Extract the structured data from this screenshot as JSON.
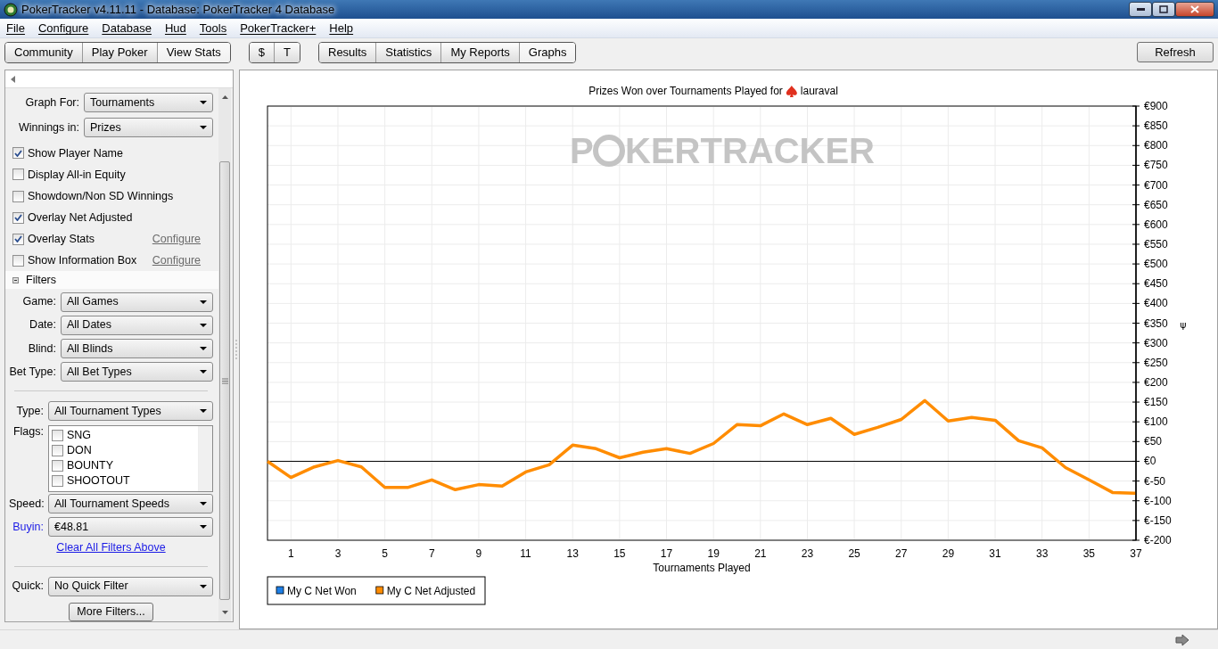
{
  "window": {
    "title": "PokerTracker v4.11.11 - Database: PokerTracker 4 Database"
  },
  "menu": [
    "File",
    "Configure",
    "Database",
    "Hud",
    "Tools",
    "PokerTracker+",
    "Help"
  ],
  "toolbar_groups": [
    {
      "buttons": [
        {
          "label": "Community",
          "selected": false
        },
        {
          "label": "Play Poker",
          "selected": false
        },
        {
          "label": "View Stats",
          "selected": true
        }
      ]
    },
    {
      "buttons": [
        {
          "label": "$",
          "selected": false
        },
        {
          "label": "T",
          "selected": false
        }
      ]
    },
    {
      "buttons": [
        {
          "label": "Results",
          "selected": false
        },
        {
          "label": "Statistics",
          "selected": false
        },
        {
          "label": "My Reports",
          "selected": false
        },
        {
          "label": "Graphs",
          "selected": true
        }
      ]
    }
  ],
  "refresh_button": "Refresh",
  "settings": {
    "selects": [
      {
        "label": "Graph For:",
        "value": "Tournaments"
      },
      {
        "label": "Winnings in:",
        "value": "Prizes"
      }
    ],
    "checkboxes": [
      {
        "label": "Show Player Name",
        "checked": true
      },
      {
        "label": "Display All-in Equity",
        "checked": false
      },
      {
        "label": "Showdown/Non SD Winnings",
        "checked": false
      },
      {
        "label": "Overlay Net Adjusted",
        "checked": true
      },
      {
        "label": "Overlay Stats",
        "checked": true,
        "link": "Configure"
      },
      {
        "label": "Show Information Box",
        "checked": false,
        "link": "Configure"
      }
    ]
  },
  "filters": {
    "title": "Filters",
    "selects": [
      {
        "label": "Game:",
        "value": "All Games"
      },
      {
        "label": "Date:",
        "value": "All Dates"
      },
      {
        "label": "Blind:",
        "value": "All Blinds"
      },
      {
        "label": "Bet Type:",
        "value": "All Bet Types"
      }
    ],
    "type": {
      "label": "Type:",
      "value": "All Tournament Types"
    },
    "flags": {
      "label": "Flags:",
      "items": [
        {
          "label": "SNG",
          "checked": false
        },
        {
          "label": "DON",
          "checked": false
        },
        {
          "label": "BOUNTY",
          "checked": false
        },
        {
          "label": "SHOOTOUT",
          "checked": false
        }
      ]
    },
    "lower_selects": [
      {
        "label": "Speed:",
        "value": "All Tournament Speeds",
        "highlighted": false
      },
      {
        "label": "Buyin:",
        "value": "€48.81",
        "highlighted": true
      }
    ],
    "clear_link": "Clear All Filters Above",
    "quick": {
      "label": "Quick:",
      "value": "No Quick Filter"
    },
    "more_button": "More Filters..."
  },
  "graph": {
    "title": "Prizes Won over Tournaments Played for",
    "player": "lauraval",
    "logo": {
      "left": "P",
      "right": "KERTRACKER"
    },
    "chart_data": {
      "type": "line",
      "grid": true,
      "xlabel": "Tournaments Played",
      "ylabel": "ψ",
      "x": [
        0,
        1,
        2,
        3,
        4,
        5,
        6,
        7,
        8,
        9,
        10,
        11,
        12,
        13,
        14,
        15,
        16,
        17,
        18,
        19,
        20,
        21,
        22,
        23,
        24,
        25,
        26,
        27,
        28,
        29,
        30,
        31,
        32,
        33,
        34,
        35,
        36,
        37
      ],
      "series": [
        {
          "name": "My C Net Won",
          "color": "#1e7fe6",
          "values": [
            null,
            null,
            null,
            null,
            null,
            null,
            null,
            null,
            null,
            null,
            null,
            null,
            null,
            null,
            null,
            null,
            null,
            null,
            null,
            null,
            null,
            null,
            null,
            null,
            null,
            null,
            null,
            null,
            null,
            null,
            null,
            null,
            null,
            null,
            null,
            null,
            null,
            null
          ]
        },
        {
          "name": "My C Net Adjusted",
          "color": "#ff8c00",
          "values": [
            0,
            -41,
            -14,
            2,
            -14,
            -66,
            -66,
            -47,
            -72,
            -59,
            -63,
            -27,
            -9,
            41,
            32,
            9,
            23,
            32,
            20,
            45,
            93,
            90,
            120,
            93,
            109,
            68,
            86,
            106,
            154,
            102,
            111,
            104,
            52,
            34,
            -16,
            -47,
            -79,
            -81
          ]
        }
      ],
      "xlim": [
        0,
        37
      ],
      "ylim": [
        -200,
        900
      ],
      "xticks": [
        1,
        3,
        5,
        7,
        9,
        11,
        13,
        15,
        17,
        19,
        21,
        23,
        25,
        27,
        29,
        31,
        33,
        35,
        37
      ],
      "yticks": [
        {
          "value": 900,
          "label": "€900"
        },
        {
          "value": 850,
          "label": "€850"
        },
        {
          "value": 800,
          "label": "€800"
        },
        {
          "value": 750,
          "label": "€750"
        },
        {
          "value": 700,
          "label": "€700"
        },
        {
          "value": 650,
          "label": "€650"
        },
        {
          "value": 600,
          "label": "€600"
        },
        {
          "value": 550,
          "label": "€550"
        },
        {
          "value": 500,
          "label": "€500"
        },
        {
          "value": 450,
          "label": "€450"
        },
        {
          "value": 400,
          "label": "€400"
        },
        {
          "value": 350,
          "label": "€350"
        },
        {
          "value": 300,
          "label": "€300"
        },
        {
          "value": 250,
          "label": "€250"
        },
        {
          "value": 200,
          "label": "€200"
        },
        {
          "value": 150,
          "label": "€150"
        },
        {
          "value": 100,
          "label": "€100"
        },
        {
          "value": 50,
          "label": "€50"
        },
        {
          "value": 0,
          "label": "€0"
        },
        {
          "value": -50,
          "label": "€-50"
        },
        {
          "value": -100,
          "label": "€-100"
        },
        {
          "value": -150,
          "label": "€-150"
        },
        {
          "value": -200,
          "label": "€-200"
        }
      ]
    }
  }
}
